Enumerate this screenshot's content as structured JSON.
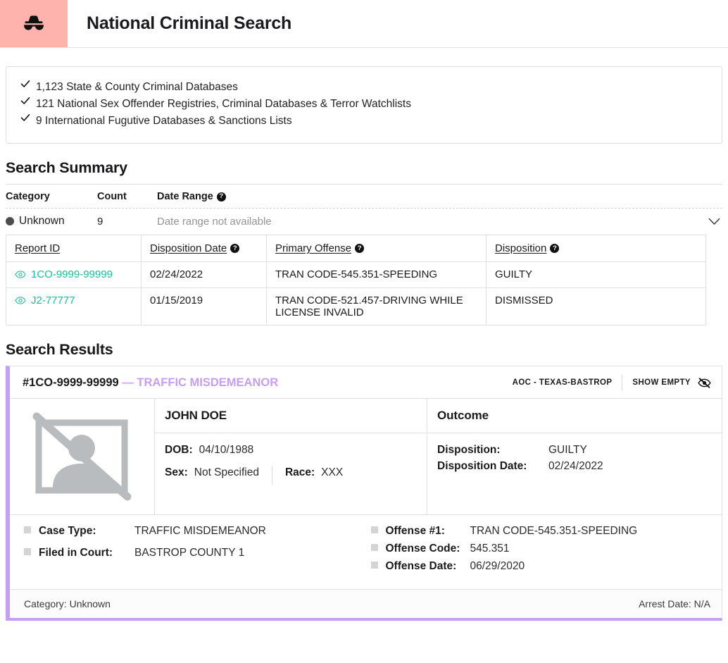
{
  "header": {
    "title": "National Criminal Search",
    "badge_icon": "incognito-icon",
    "badge_color": "#ffb3ac"
  },
  "coverage": {
    "items": [
      "1,123 State & County Criminal Databases",
      "121 National Sex Offender Registries, Criminal Databases & Terror Watchlists",
      "9 International Fugutive Databases & Sanctions Lists"
    ]
  },
  "search_summary": {
    "title": "Search Summary",
    "columns": {
      "category": "Category",
      "count": "Count",
      "date_range": "Date Range",
      "help_glyph": "?"
    },
    "row": {
      "category": "Unknown",
      "category_dot_color": "#4d4d4d",
      "count": "9",
      "date_range": "Date range not available",
      "expander_icon": "chevron-down-icon"
    },
    "detail_table": {
      "headers": [
        "Report ID",
        "Disposition Date",
        "Primary Offense",
        "Disposition"
      ],
      "rows": [
        {
          "report_id": "1CO-9999-99999",
          "disposition_date": "02/24/2022",
          "primary_offense": "TRAN CODE-545.351-SPEEDING",
          "disposition": "GUILTY"
        },
        {
          "report_id": "J2-77777",
          "disposition_date": "01/15/2019",
          "primary_offense": "TRAN CODE-521.457-DRIVING WHILE LICENSE INVALID",
          "disposition": "DISMISSED"
        }
      ],
      "link_color": "#12c29a",
      "row_icon": "eye-icon"
    }
  },
  "search_results": {
    "title": "Search Results",
    "card": {
      "accent_color": "#c79ef2",
      "case_number": "#1CO-9999-99999",
      "dash": "—",
      "offense_type": "TRAFFIC MISDEMEANOR",
      "source": "AOC - TEXAS-BASTROP",
      "show_empty_label": "SHOW EMPTY",
      "show_empty_icon": "eye-slash-icon",
      "photo_placeholder_icon": "no-image-icon",
      "person": {
        "name": "JOHN DOE",
        "dob_label": "DOB:",
        "dob_value": "04/10/1988",
        "sex_label": "Sex:",
        "sex_value": "Not Specified",
        "race_label": "Race:",
        "race_value": "XXX"
      },
      "outcome": {
        "heading": "Outcome",
        "disposition_label": "Disposition:",
        "disposition_value": "GUILTY",
        "disposition_date_label": "Disposition Date:",
        "disposition_date_value": "02/24/2022"
      },
      "facts_left": [
        {
          "key": "Case Type:",
          "value": "TRAFFIC MISDEMEANOR"
        },
        {
          "key": "Filed in Court:",
          "value": "BASTROP COUNTY 1"
        }
      ],
      "facts_right": [
        {
          "key": "Offense #1:",
          "value": "TRAN CODE-545.351-SPEEDING"
        },
        {
          "key": "Offense Code:",
          "value": "545.351"
        },
        {
          "key": "Offense Date:",
          "value": "06/29/2020"
        }
      ],
      "footer": {
        "category": "Category: Unknown",
        "arrest_date": "Arrest Date: N/A"
      }
    }
  }
}
